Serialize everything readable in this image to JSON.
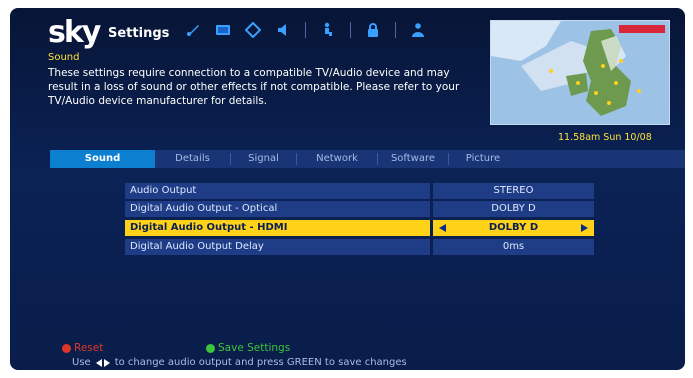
{
  "header": {
    "logo": "sky",
    "title": "Settings",
    "icons": [
      "wrench-icon",
      "tv-icon",
      "tag-icon",
      "speaker-icon",
      "person-sitting-icon",
      "lock-icon",
      "person-icon"
    ]
  },
  "section": {
    "title": "Sound",
    "description": "These settings require connection to a compatible TV/Audio device and may result in a loss of sound or other effects if not compatible. Please refer to your TV/Audio device manufacturer for details."
  },
  "clock": "11.58am Sun 10/08",
  "tabs": [
    {
      "label": "Sound",
      "active": true
    },
    {
      "label": "Details",
      "active": false
    },
    {
      "label": "Signal",
      "active": false
    },
    {
      "label": "Network",
      "active": false
    },
    {
      "label": "Software",
      "active": false
    },
    {
      "label": "Picture",
      "active": false
    }
  ],
  "settings": [
    {
      "label": "Audio Output",
      "value": "STEREO",
      "selected": false
    },
    {
      "label": "Digital Audio Output - Optical",
      "value": "DOLBY D",
      "selected": false
    },
    {
      "label": "Digital Audio Output - HDMI",
      "value": "DOLBY D",
      "selected": true
    },
    {
      "label": "Digital Audio Output Delay",
      "value": "0ms",
      "selected": false
    }
  ],
  "footer": {
    "reset_label": "Reset",
    "save_label": "Save Settings",
    "hint_pre": "Use",
    "hint_post": "to change audio output and press GREEN to save changes"
  },
  "colors": {
    "highlight": "#ffd21a",
    "accent_text": "#ffe23a",
    "active_tab": "#0d7fd1",
    "red_button": "#e0352b",
    "green_button": "#3cc43c"
  }
}
